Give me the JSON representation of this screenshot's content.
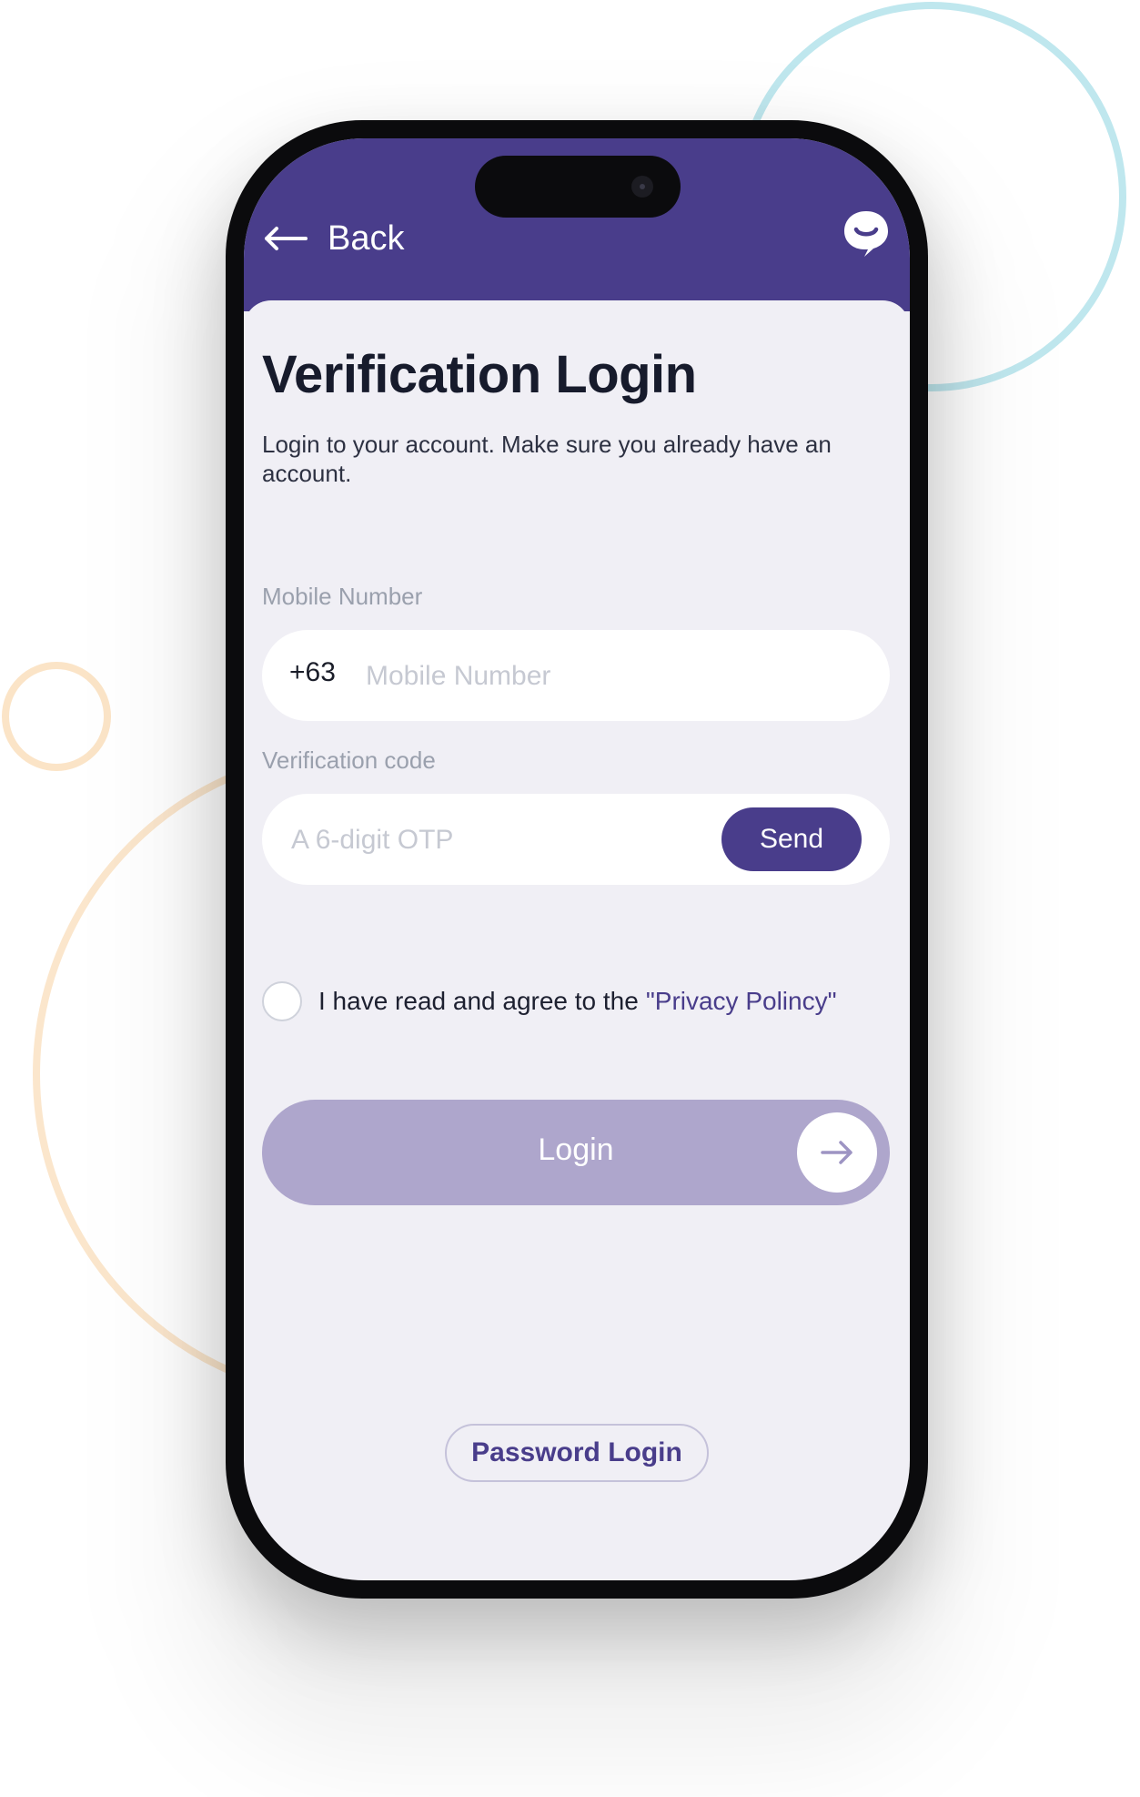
{
  "colors": {
    "brand": "#493d8b",
    "login_disabled": "#aea6cc",
    "background": "#f0eff5"
  },
  "header": {
    "back_label": "Back",
    "back_icon": "arrow-left-icon",
    "chat_icon": "chat-bubble-icon"
  },
  "page": {
    "title": "Verification Login",
    "subtitle": "Login to your account. Make sure you already have an account."
  },
  "mobile": {
    "label": "Mobile Number",
    "country_code": "+63",
    "value": "",
    "placeholder": "Mobile Number"
  },
  "otp": {
    "label": "Verification code",
    "value": "",
    "placeholder": "A 6-digit OTP",
    "send_label": "Send"
  },
  "agreement": {
    "checked": false,
    "text": "I have read and agree to the",
    "link": "\"Privacy Polincy\""
  },
  "login": {
    "label": "Login",
    "arrow_icon": "arrow-right-icon"
  },
  "password_login": {
    "label": "Password Login"
  }
}
